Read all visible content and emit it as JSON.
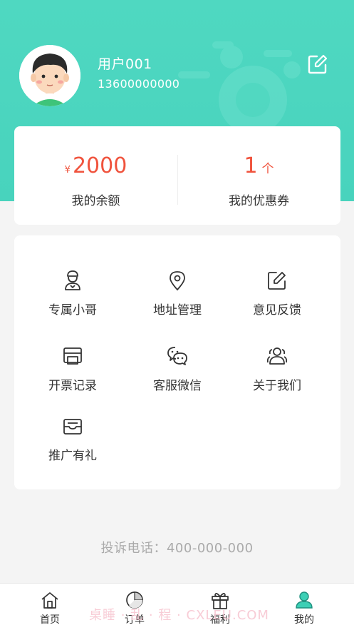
{
  "user": {
    "name": "用户001",
    "phone": "13600000000"
  },
  "stats": {
    "balance_currency": "¥",
    "balance_value": "2000",
    "balance_label": "我的余额",
    "coupon_value": "1",
    "coupon_unit": "个",
    "coupon_label": "我的优惠券"
  },
  "menu": [
    {
      "label": "专属小哥",
      "icon": "courier-icon"
    },
    {
      "label": "地址管理",
      "icon": "location-pin-icon"
    },
    {
      "label": "意见反馈",
      "icon": "edit-feedback-icon"
    },
    {
      "label": "开票记录",
      "icon": "printer-icon"
    },
    {
      "label": "客服微信",
      "icon": "wechat-icon"
    },
    {
      "label": "关于我们",
      "icon": "people-icon"
    },
    {
      "label": "推广有礼",
      "icon": "inbox-icon"
    }
  ],
  "complaint_phone": "投诉电话：400-000-000",
  "tabbar": [
    {
      "label": "首页",
      "icon": "home-icon"
    },
    {
      "label": "订单",
      "icon": "pie-chart-icon"
    },
    {
      "label": "福利",
      "icon": "gift-icon"
    },
    {
      "label": "我的",
      "icon": "user-icon",
      "active": true
    }
  ],
  "watermark": "桌睡 · 乱 · 程 · CXLEU.COM",
  "colors": {
    "header": "#4fd8c1",
    "accent_red": "#f0533d",
    "active_tab": "#3ccfb5"
  }
}
